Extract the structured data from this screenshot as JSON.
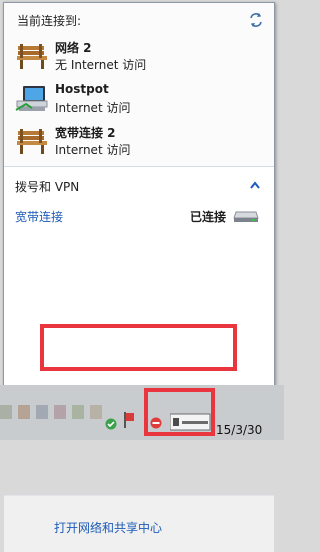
{
  "flyout": {
    "header": "当前连接到:",
    "networks": [
      {
        "name": "网络  2",
        "status": "无 Internet 访问",
        "icon": "network-bench-icon"
      },
      {
        "name": "Hostpot",
        "status": "Internet 访问",
        "icon": "hotspot-computer-icon"
      },
      {
        "name": "宽带连接  2",
        "status": "Internet 访问",
        "icon": "network-bench-icon"
      }
    ],
    "dialup_section": {
      "title": "拨号和 VPN",
      "connection_name": "宽带连接",
      "connection_status": "已连接"
    },
    "footer_link": "打开网络和共享中心"
  },
  "taskbar": {
    "clock": "15/3/30"
  },
  "colors": {
    "link": "#1d5bb8",
    "highlight": "#e8353e"
  }
}
